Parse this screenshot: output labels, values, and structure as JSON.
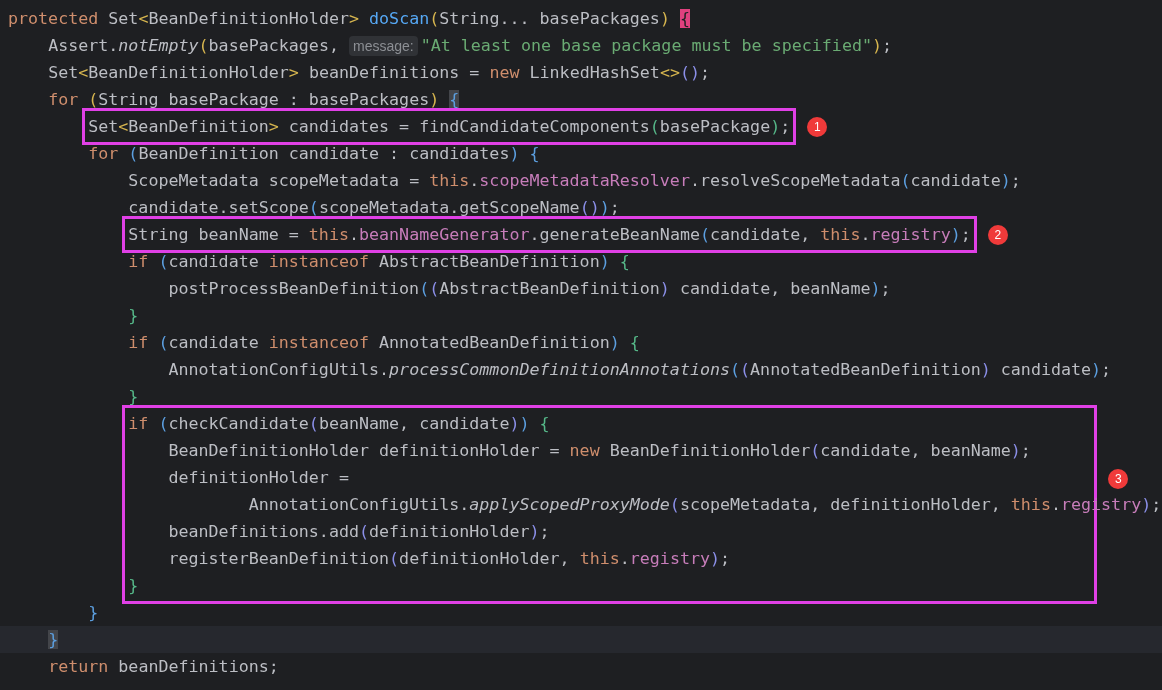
{
  "editor": {
    "lines": [
      {
        "kind": "code",
        "current": false,
        "tokens": [
          {
            "kind": "kw",
            "text": "protected"
          },
          {
            "kind": "plain",
            "text": " Set"
          },
          {
            "kind": "b1",
            "text": "<"
          },
          {
            "kind": "plain",
            "text": "BeanDefinitionHolder"
          },
          {
            "kind": "b1",
            "text": "> "
          },
          {
            "kind": "decl",
            "text": "doScan"
          },
          {
            "kind": "b1",
            "text": "("
          },
          {
            "kind": "plain",
            "text": "String... basePackages"
          },
          {
            "kind": "b1",
            "text": ") "
          },
          {
            "kind": "flag",
            "text": "{"
          }
        ]
      },
      {
        "kind": "code",
        "current": false,
        "tokens": [
          {
            "kind": "plain",
            "text": "    Assert."
          },
          {
            "kind": "static",
            "text": "notEmpty"
          },
          {
            "kind": "b1",
            "text": "("
          },
          {
            "kind": "plain",
            "text": "basePackages, "
          },
          {
            "kind": "hint",
            "text": "message:"
          },
          {
            "kind": "str",
            "text": "\"At least one base package must be specified\""
          },
          {
            "kind": "b1",
            "text": ")"
          },
          {
            "kind": "plain",
            "text": ";"
          }
        ]
      },
      {
        "kind": "code",
        "current": false,
        "tokens": [
          {
            "kind": "plain",
            "text": "    Set"
          },
          {
            "kind": "b1",
            "text": "<"
          },
          {
            "kind": "plain",
            "text": "BeanDefinitionHolder"
          },
          {
            "kind": "b1",
            "text": ">"
          },
          {
            "kind": "plain",
            "text": " beanDefinitions = "
          },
          {
            "kind": "kw",
            "text": "new"
          },
          {
            "kind": "plain",
            "text": " LinkedHashSet"
          },
          {
            "kind": "b1",
            "text": "<>"
          },
          {
            "kind": "b4",
            "text": "()"
          },
          {
            "kind": "plain",
            "text": ";"
          }
        ]
      },
      {
        "kind": "code",
        "current": false,
        "tokens": [
          {
            "kind": "kw",
            "text": "    for "
          },
          {
            "kind": "b1",
            "text": "("
          },
          {
            "kind": "plain",
            "text": "String basePackage : basePackages"
          },
          {
            "kind": "b1",
            "text": ") "
          },
          {
            "kind": "match",
            "text": "{"
          }
        ]
      },
      {
        "kind": "annotation",
        "badge": "1",
        "lines": [
          {
            "kind": "code",
            "current": false,
            "tokens": [
              {
                "kind": "plain",
                "text": "        Set"
              },
              {
                "kind": "b1",
                "text": "<"
              },
              {
                "kind": "plain",
                "text": "BeanDefinition"
              },
              {
                "kind": "b1",
                "text": ">"
              },
              {
                "kind": "plain",
                "text": " candidates = findCandidateComponents"
              },
              {
                "kind": "b3",
                "text": "("
              },
              {
                "kind": "plain",
                "text": "basePackage"
              },
              {
                "kind": "b3",
                "text": ")"
              },
              {
                "kind": "plain",
                "text": ";"
              }
            ]
          }
        ]
      },
      {
        "kind": "code",
        "current": false,
        "tokens": [
          {
            "kind": "kw",
            "text": "        for "
          },
          {
            "kind": "b2",
            "text": "("
          },
          {
            "kind": "plain",
            "text": "BeanDefinition candidate : candidates"
          },
          {
            "kind": "b2",
            "text": ") {"
          }
        ]
      },
      {
        "kind": "code",
        "current": false,
        "tokens": [
          {
            "kind": "plain",
            "text": "            ScopeMetadata scopeMetadata = "
          },
          {
            "kind": "kw",
            "text": "this"
          },
          {
            "kind": "plain",
            "text": "."
          },
          {
            "kind": "field",
            "text": "scopeMetadataResolver"
          },
          {
            "kind": "plain",
            "text": ".resolveScopeMetadata"
          },
          {
            "kind": "b2",
            "text": "("
          },
          {
            "kind": "plain",
            "text": "candidate"
          },
          {
            "kind": "b2",
            "text": ")"
          },
          {
            "kind": "plain",
            "text": ";"
          }
        ]
      },
      {
        "kind": "code",
        "current": false,
        "tokens": [
          {
            "kind": "plain",
            "text": "            candidate.setScope"
          },
          {
            "kind": "b2",
            "text": "("
          },
          {
            "kind": "plain",
            "text": "scopeMetadata.getScopeName"
          },
          {
            "kind": "b4",
            "text": "()"
          },
          {
            "kind": "b2",
            "text": ")"
          },
          {
            "kind": "plain",
            "text": ";"
          }
        ]
      },
      {
        "kind": "annotation",
        "badge": "2",
        "lines": [
          {
            "kind": "code",
            "current": false,
            "tokens": [
              {
                "kind": "plain",
                "text": "            String beanName = "
              },
              {
                "kind": "kw",
                "text": "this"
              },
              {
                "kind": "plain",
                "text": "."
              },
              {
                "kind": "field",
                "text": "beanNameGenerator"
              },
              {
                "kind": "plain",
                "text": ".generateBeanName"
              },
              {
                "kind": "b2",
                "text": "("
              },
              {
                "kind": "plain",
                "text": "candidate, "
              },
              {
                "kind": "kw",
                "text": "this"
              },
              {
                "kind": "plain",
                "text": "."
              },
              {
                "kind": "field",
                "text": "registry"
              },
              {
                "kind": "b2",
                "text": ")"
              },
              {
                "kind": "plain",
                "text": ";"
              }
            ]
          }
        ]
      },
      {
        "kind": "code",
        "current": false,
        "tokens": [
          {
            "kind": "kw",
            "text": "            if "
          },
          {
            "kind": "b2",
            "text": "("
          },
          {
            "kind": "plain",
            "text": "candidate "
          },
          {
            "kind": "kw",
            "text": "instanceof"
          },
          {
            "kind": "plain",
            "text": " AbstractBeanDefinition"
          },
          {
            "kind": "b2",
            "text": ") "
          },
          {
            "kind": "b3",
            "text": "{"
          }
        ]
      },
      {
        "kind": "code",
        "current": false,
        "tokens": [
          {
            "kind": "plain",
            "text": "                postProcessBeanDefinition"
          },
          {
            "kind": "b2",
            "text": "("
          },
          {
            "kind": "b4",
            "text": "("
          },
          {
            "kind": "plain",
            "text": "AbstractBeanDefinition"
          },
          {
            "kind": "b4",
            "text": ")"
          },
          {
            "kind": "plain",
            "text": " candidate, beanName"
          },
          {
            "kind": "b2",
            "text": ")"
          },
          {
            "kind": "plain",
            "text": ";"
          }
        ]
      },
      {
        "kind": "code",
        "current": false,
        "tokens": [
          {
            "kind": "b3",
            "text": "            }"
          }
        ]
      },
      {
        "kind": "code",
        "current": false,
        "tokens": [
          {
            "kind": "kw",
            "text": "            if "
          },
          {
            "kind": "b2",
            "text": "("
          },
          {
            "kind": "plain",
            "text": "candidate "
          },
          {
            "kind": "kw",
            "text": "instanceof"
          },
          {
            "kind": "plain",
            "text": " AnnotatedBeanDefinition"
          },
          {
            "kind": "b2",
            "text": ") "
          },
          {
            "kind": "b3",
            "text": "{"
          }
        ]
      },
      {
        "kind": "code",
        "current": false,
        "tokens": [
          {
            "kind": "plain",
            "text": "                AnnotationConfigUtils."
          },
          {
            "kind": "static",
            "text": "processCommonDefinitionAnnotations"
          },
          {
            "kind": "b2",
            "text": "("
          },
          {
            "kind": "b4",
            "text": "("
          },
          {
            "kind": "plain",
            "text": "AnnotatedBeanDefinition"
          },
          {
            "kind": "b4",
            "text": ")"
          },
          {
            "kind": "plain",
            "text": " candidate"
          },
          {
            "kind": "b2",
            "text": ")"
          },
          {
            "kind": "plain",
            "text": ";"
          }
        ]
      },
      {
        "kind": "code",
        "current": false,
        "tokens": [
          {
            "kind": "b3",
            "text": "            }"
          }
        ]
      },
      {
        "kind": "annotation",
        "badge": "3",
        "lines": [
          {
            "kind": "code",
            "current": false,
            "tokens": [
              {
                "kind": "kw",
                "text": "            if "
              },
              {
                "kind": "b2",
                "text": "("
              },
              {
                "kind": "plain",
                "text": "checkCandidate"
              },
              {
                "kind": "b4",
                "text": "("
              },
              {
                "kind": "plain",
                "text": "beanName, candidate"
              },
              {
                "kind": "b4",
                "text": ")"
              },
              {
                "kind": "b2",
                "text": ") "
              },
              {
                "kind": "b3",
                "text": "{"
              }
            ]
          },
          {
            "kind": "code",
            "current": false,
            "tokens": [
              {
                "kind": "plain",
                "text": "                BeanDefinitionHolder definitionHolder = "
              },
              {
                "kind": "kw",
                "text": "new"
              },
              {
                "kind": "plain",
                "text": " BeanDefinitionHolder"
              },
              {
                "kind": "b4",
                "text": "("
              },
              {
                "kind": "plain",
                "text": "candidate, beanName"
              },
              {
                "kind": "b4",
                "text": ")"
              },
              {
                "kind": "plain",
                "text": ";"
              }
            ]
          },
          {
            "kind": "code",
            "current": false,
            "tokens": [
              {
                "kind": "plain",
                "text": "                definitionHolder ="
              }
            ]
          },
          {
            "kind": "code",
            "current": false,
            "tokens": [
              {
                "kind": "plain",
                "text": "                        AnnotationConfigUtils."
              },
              {
                "kind": "static",
                "text": "applyScopedProxyMode"
              },
              {
                "kind": "b4",
                "text": "("
              },
              {
                "kind": "plain",
                "text": "scopeMetadata, definitionHolder, "
              },
              {
                "kind": "kw",
                "text": "this"
              },
              {
                "kind": "plain",
                "text": "."
              },
              {
                "kind": "field",
                "text": "registry"
              },
              {
                "kind": "b4",
                "text": ")"
              },
              {
                "kind": "plain",
                "text": ";"
              }
            ]
          },
          {
            "kind": "code",
            "current": false,
            "tokens": [
              {
                "kind": "plain",
                "text": "                beanDefinitions.add"
              },
              {
                "kind": "b4",
                "text": "("
              },
              {
                "kind": "plain",
                "text": "definitionHolder"
              },
              {
                "kind": "b4",
                "text": ")"
              },
              {
                "kind": "plain",
                "text": ";"
              }
            ]
          },
          {
            "kind": "code",
            "current": false,
            "tokens": [
              {
                "kind": "plain",
                "text": "                registerBeanDefinition"
              },
              {
                "kind": "b4",
                "text": "("
              },
              {
                "kind": "plain",
                "text": "definitionHolder, "
              },
              {
                "kind": "kw",
                "text": "this"
              },
              {
                "kind": "plain",
                "text": "."
              },
              {
                "kind": "field",
                "text": "registry"
              },
              {
                "kind": "b4",
                "text": ")"
              },
              {
                "kind": "plain",
                "text": ";"
              }
            ]
          },
          {
            "kind": "code",
            "current": false,
            "tokens": [
              {
                "kind": "b3",
                "text": "            }"
              }
            ]
          }
        ]
      },
      {
        "kind": "code",
        "current": false,
        "tokens": [
          {
            "kind": "b2",
            "text": "        }"
          }
        ]
      },
      {
        "kind": "code",
        "current": true,
        "tokens": [
          {
            "kind": "match",
            "text": "    }"
          }
        ]
      },
      {
        "kind": "code",
        "current": false,
        "tokens": [
          {
            "kind": "kw",
            "text": "    return"
          },
          {
            "kind": "plain",
            "text": " beanDefinitions;"
          }
        ]
      }
    ]
  }
}
